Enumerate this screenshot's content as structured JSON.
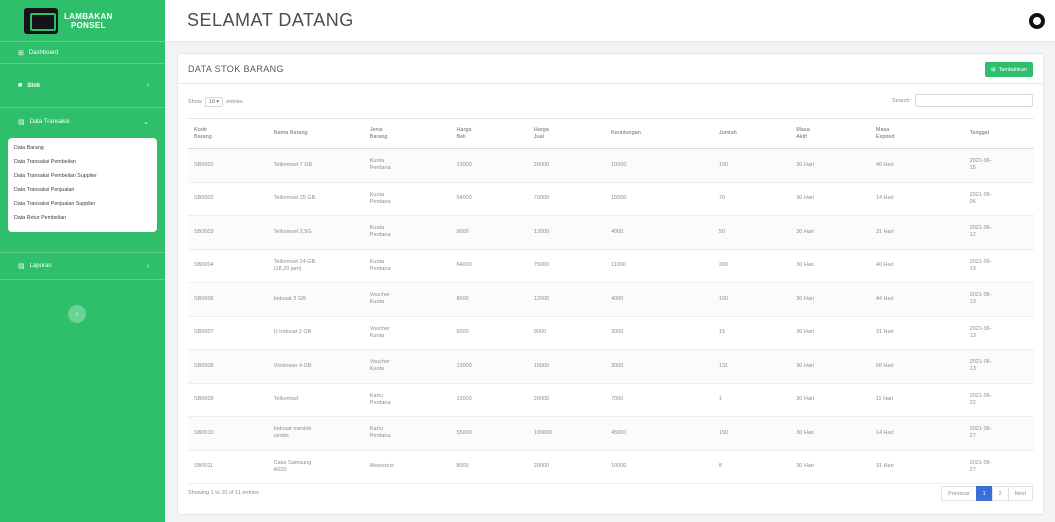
{
  "sidebar": {
    "brand": {
      "line1": "LAMBAKAN",
      "line2": "PONSEL"
    },
    "items": [
      {
        "label": "Dashboard",
        "icon": "dashboard-icon"
      },
      {
        "label": "Stok",
        "icon": "box-icon"
      },
      {
        "label": "Data Transaksi",
        "icon": "folder-icon"
      },
      {
        "label": "Laporan",
        "icon": "report-icon"
      }
    ],
    "submenu": [
      "Data Barang",
      "Data Transaksi Pembelian",
      "Data Transaksi Pembelian Supplier",
      "Data Transaksi Penjualan",
      "Data Transaksi Penjualan Supplier",
      "Data Retur Pembelian"
    ]
  },
  "topbar": {
    "title": "SELAMAT DATANG"
  },
  "card": {
    "title": "DATA STOK BARANG",
    "add_button": "Tambahkan",
    "show_label": "Show",
    "show_value": "10",
    "entries_label": "entries",
    "search_label": "Search:",
    "search_placeholder": "",
    "info": "Showing 1 to 10 of 11 entries",
    "pager": {
      "prev": "Previous",
      "pages": [
        "1",
        "2"
      ],
      "next": "Next"
    }
  },
  "table": {
    "columns": [
      [
        "Kode",
        "Barang"
      ],
      [
        "Nama Barang"
      ],
      [
        "Jenis",
        "Barang"
      ],
      [
        "Harga",
        "Beli"
      ],
      [
        "Harga",
        "Jual"
      ],
      [
        "Keuntungan"
      ],
      [
        "Jumlah"
      ],
      [
        "Masa",
        "Aktif"
      ],
      [
        "Masa",
        "Expired"
      ],
      [
        "Tanggal"
      ]
    ],
    "rows": [
      [
        [
          "SB0001"
        ],
        [
          "Telkomsel 7 GB"
        ],
        [
          "Kuota",
          "Perdana"
        ],
        [
          "13000"
        ],
        [
          "20000"
        ],
        [
          "10000"
        ],
        [
          "100"
        ],
        [
          "30 Hari"
        ],
        [
          "40 Hari"
        ],
        [
          "2021-06-",
          "15"
        ]
      ],
      [
        [
          "SB0002"
        ],
        [
          "Telkomsel 25 GB"
        ],
        [
          "Kuota",
          "Perdana"
        ],
        [
          "54000"
        ],
        [
          "70000"
        ],
        [
          "15000"
        ],
        [
          "70"
        ],
        [
          "30 Hari"
        ],
        [
          "14 Hari"
        ],
        [
          "2021-06-",
          "06"
        ]
      ],
      [
        [
          "SB0003"
        ],
        [
          "Telkomsel 2,5G"
        ],
        [
          "Kuota",
          "Perdana"
        ],
        [
          "9000"
        ],
        [
          "13000"
        ],
        [
          "4000"
        ],
        [
          "50"
        ],
        [
          "30 Hari"
        ],
        [
          "31 Hari"
        ],
        [
          "2021-06-",
          "12"
        ]
      ],
      [
        [
          "SB0004"
        ],
        [
          "Telkomsel 24 GB",
          "(18,20 jam)"
        ],
        [
          "Kuota",
          "Perdana"
        ],
        [
          "64000"
        ],
        [
          "75000"
        ],
        [
          "11000"
        ],
        [
          "200"
        ],
        [
          "30 Hari"
        ],
        [
          "40 Hari"
        ],
        [
          "2021-06-",
          "13"
        ]
      ],
      [
        [
          "SB0006"
        ],
        [
          "Indosat 3 GB"
        ],
        [
          "Voucher",
          "Kuota"
        ],
        [
          "8000"
        ],
        [
          "12000"
        ],
        [
          "4000"
        ],
        [
          "100"
        ],
        [
          "30 Hari"
        ],
        [
          "44 Hari"
        ],
        [
          "2021-06-",
          "13"
        ]
      ],
      [
        [
          "SB0007"
        ],
        [
          "U Indosat 2 GB"
        ],
        [
          "Voucher",
          "Kuota"
        ],
        [
          "6000"
        ],
        [
          "9000"
        ],
        [
          "3000"
        ],
        [
          "15"
        ],
        [
          "30 Hari"
        ],
        [
          "31 Hari"
        ],
        [
          "2021-06-",
          "13"
        ]
      ],
      [
        [
          "SB0008"
        ],
        [
          "Vivolovan 4 GB"
        ],
        [
          "Voucher",
          "Kuota"
        ],
        [
          "13000"
        ],
        [
          "16000"
        ],
        [
          "3000"
        ],
        [
          "131"
        ],
        [
          "30 Hari"
        ],
        [
          "60 Hari"
        ],
        [
          "2021-06-",
          "13"
        ]
      ],
      [
        [
          "SB0009"
        ],
        [
          "Telkomsel"
        ],
        [
          "Kartu",
          "Perdana"
        ],
        [
          "13000"
        ],
        [
          "20000"
        ],
        [
          "7000"
        ],
        [
          "1"
        ],
        [
          "30 Hari"
        ],
        [
          "11 Hari"
        ],
        [
          "2021-06-",
          "22"
        ]
      ],
      [
        [
          "SB0010"
        ],
        [
          "Indosat mentok",
          "cerahi"
        ],
        [
          "Kartu",
          "Perdana"
        ],
        [
          "55000"
        ],
        [
          "100000"
        ],
        [
          "45000"
        ],
        [
          "150"
        ],
        [
          "30 Hari"
        ],
        [
          "14 Hari"
        ],
        [
          "2021-06-",
          "27"
        ]
      ],
      [
        [
          "SB0011"
        ],
        [
          "Case Samsung",
          "A020"
        ],
        [
          "Aksesoris"
        ],
        [
          "8000"
        ],
        [
          "20000"
        ],
        [
          "10000"
        ],
        [
          "8"
        ],
        [
          "30 Hari"
        ],
        [
          "31 Hari"
        ],
        [
          "2021-06-",
          "27"
        ]
      ]
    ]
  }
}
